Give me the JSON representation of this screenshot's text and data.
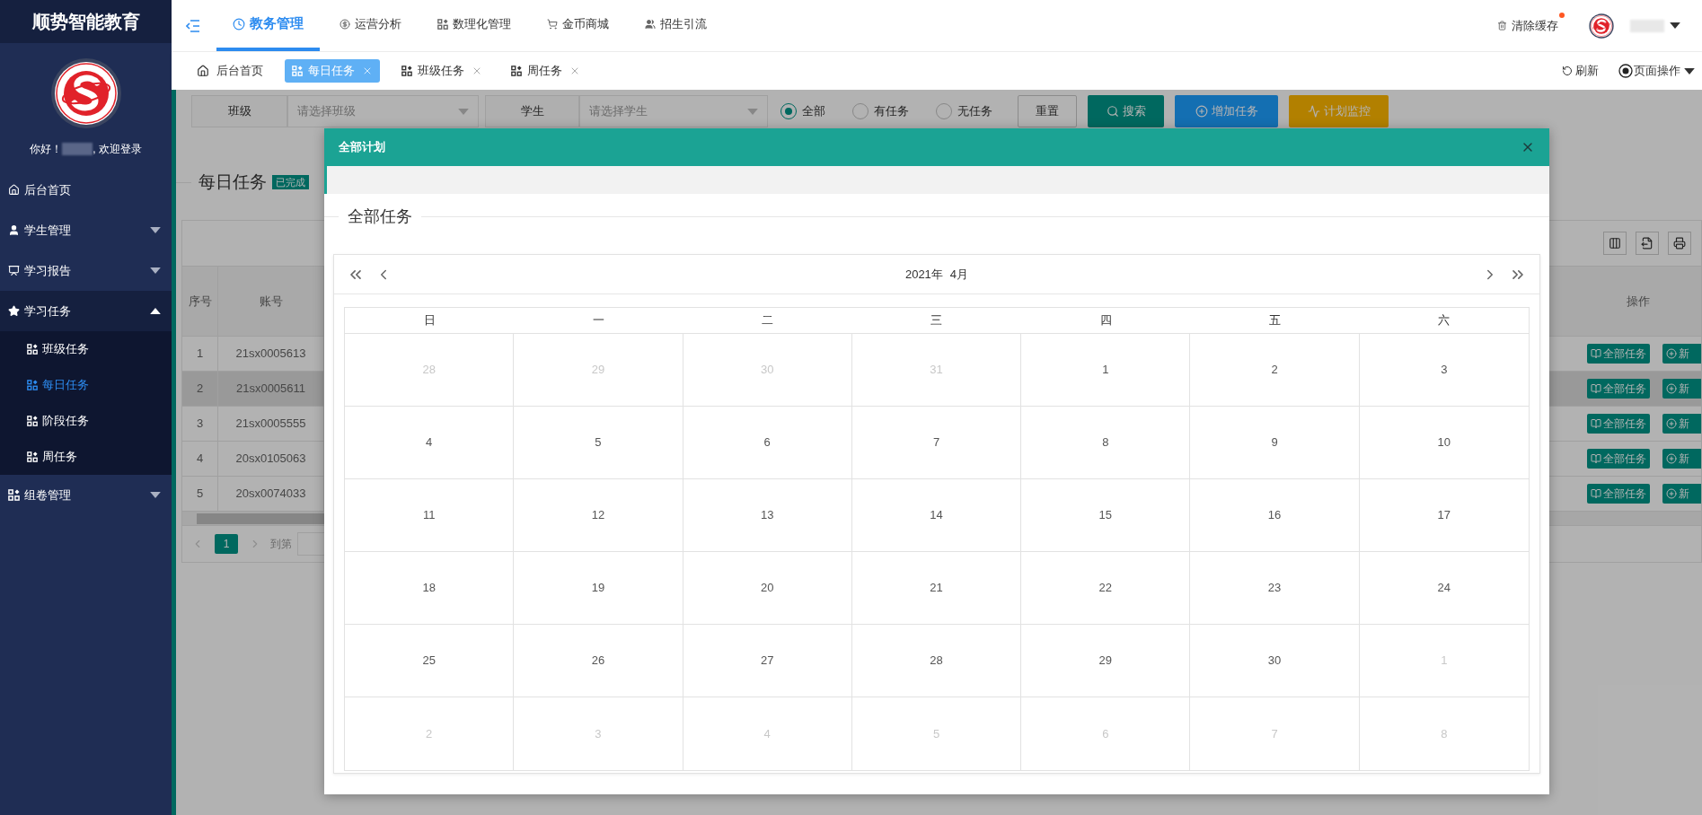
{
  "sidebar": {
    "brand": "顺势智能教育",
    "greeting_prefix": "你好！",
    "greeting_suffix": ", 欢迎登录",
    "menu": [
      {
        "label": "后台首页",
        "kind": "link"
      },
      {
        "label": "学生管理",
        "kind": "group",
        "expanded": false
      },
      {
        "label": "学习报告",
        "kind": "group",
        "expanded": false
      },
      {
        "label": "学习任务",
        "kind": "group",
        "expanded": true,
        "children": [
          {
            "label": "班级任务",
            "selected": false
          },
          {
            "label": "每日任务",
            "selected": true
          },
          {
            "label": "阶段任务",
            "selected": false
          },
          {
            "label": "周任务",
            "selected": false
          }
        ]
      },
      {
        "label": "组卷管理",
        "kind": "group",
        "expanded": false
      }
    ]
  },
  "topbar": {
    "nav": [
      {
        "label": "教务管理",
        "selected": true
      },
      {
        "label": "运营分析",
        "selected": false
      },
      {
        "label": "数理化管理",
        "selected": false
      },
      {
        "label": "金币商城",
        "selected": false
      },
      {
        "label": "招生引流",
        "selected": false
      }
    ],
    "clear_cache": "清除缓存",
    "has_notice": true
  },
  "tabs": [
    {
      "label": "后台首页",
      "closable": false,
      "selected": false
    },
    {
      "label": "每日任务",
      "closable": true,
      "selected": true
    },
    {
      "label": "班级任务",
      "closable": true,
      "selected": false
    },
    {
      "label": "周任务",
      "closable": true,
      "selected": false
    }
  ],
  "tab_actions": {
    "refresh": "刷新",
    "page_ops": "页面操作"
  },
  "filters": {
    "class_label": "班级",
    "class_placeholder": "请选择班级",
    "student_label": "学生",
    "student_placeholder": "请选择学生",
    "radios": [
      {
        "label": "全部",
        "selected": true
      },
      {
        "label": "有任务",
        "selected": false
      },
      {
        "label": "无任务",
        "selected": false
      }
    ],
    "buttons": [
      {
        "label": "重置",
        "kind": "plain"
      },
      {
        "label": "搜索",
        "kind": "search"
      },
      {
        "label": "增加任务",
        "kind": "add"
      },
      {
        "label": "计划监控",
        "kind": "monitor"
      }
    ]
  },
  "page": {
    "title": "每日任务",
    "badge": "已完成"
  },
  "table": {
    "columns": [
      "序号",
      "账号"
    ],
    "action_column": "操作",
    "rows": [
      {
        "index": "1",
        "account": "21sx0005613",
        "highlighted": false,
        "actions": [
          "全部任务",
          "新"
        ]
      },
      {
        "index": "2",
        "account": "21sx0005611",
        "highlighted": true,
        "actions": [
          "全部任务",
          "新"
        ]
      },
      {
        "index": "3",
        "account": "21sx0005555",
        "highlighted": false,
        "actions": [
          "全部任务",
          "新"
        ]
      },
      {
        "index": "4",
        "account": "20sx0105063",
        "highlighted": false,
        "actions": [
          "全部任务",
          "新"
        ]
      },
      {
        "index": "5",
        "account": "20sx0074033",
        "highlighted": false,
        "actions": [
          "全部任务",
          "新"
        ]
      }
    ]
  },
  "pagination": {
    "pages": [
      {
        "label": "1",
        "selected": true
      }
    ],
    "goto": "到第"
  },
  "modal": {
    "title": "全部计划",
    "section": "全部任务",
    "calendar": {
      "year": "2021年",
      "month": "4月",
      "weekdays": [
        "日",
        "一",
        "二",
        "三",
        "四",
        "五",
        "六"
      ],
      "weeks": [
        [
          {
            "day": "28",
            "in_month": false
          },
          {
            "day": "29",
            "in_month": false
          },
          {
            "day": "30",
            "in_month": false
          },
          {
            "day": "31",
            "in_month": false
          },
          {
            "day": "1",
            "in_month": true
          },
          {
            "day": "2",
            "in_month": true
          },
          {
            "day": "3",
            "in_month": true
          }
        ],
        [
          {
            "day": "4",
            "in_month": true
          },
          {
            "day": "5",
            "in_month": true
          },
          {
            "day": "6",
            "in_month": true
          },
          {
            "day": "7",
            "in_month": true
          },
          {
            "day": "8",
            "in_month": true
          },
          {
            "day": "9",
            "in_month": true
          },
          {
            "day": "10",
            "in_month": true
          }
        ],
        [
          {
            "day": "11",
            "in_month": true
          },
          {
            "day": "12",
            "in_month": true
          },
          {
            "day": "13",
            "in_month": true
          },
          {
            "day": "14",
            "in_month": true
          },
          {
            "day": "15",
            "in_month": true
          },
          {
            "day": "16",
            "in_month": true
          },
          {
            "day": "17",
            "in_month": true
          }
        ],
        [
          {
            "day": "18",
            "in_month": true
          },
          {
            "day": "19",
            "in_month": true
          },
          {
            "day": "20",
            "in_month": true
          },
          {
            "day": "21",
            "in_month": true
          },
          {
            "day": "22",
            "in_month": true
          },
          {
            "day": "23",
            "in_month": true
          },
          {
            "day": "24",
            "in_month": true
          }
        ],
        [
          {
            "day": "25",
            "in_month": true
          },
          {
            "day": "26",
            "in_month": true
          },
          {
            "day": "27",
            "in_month": true
          },
          {
            "day": "28",
            "in_month": true
          },
          {
            "day": "29",
            "in_month": true
          },
          {
            "day": "30",
            "in_month": true
          },
          {
            "day": "1",
            "in_month": false
          }
        ],
        [
          {
            "day": "2",
            "in_month": false
          },
          {
            "day": "3",
            "in_month": false
          },
          {
            "day": "4",
            "in_month": false
          },
          {
            "day": "5",
            "in_month": false
          },
          {
            "day": "6",
            "in_month": false
          },
          {
            "day": "7",
            "in_month": false
          },
          {
            "day": "8",
            "in_month": false
          }
        ]
      ]
    }
  }
}
